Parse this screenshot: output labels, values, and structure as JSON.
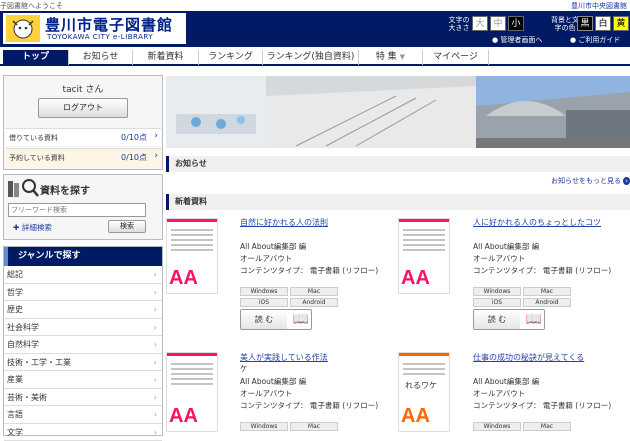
{
  "top": {
    "welcome": "子図書館へようこそ",
    "link": "豊川市中央図書館"
  },
  "header": {
    "logo_title": "豊川市電子図書館",
    "logo_sub": "TOYOKAWA CITY e-LIBRARY",
    "fontsize_label": "文字の大きさ",
    "fontsize_options": [
      "大",
      "中",
      "小"
    ],
    "color_label": "背景と文字の色",
    "color_options": [
      "黒",
      "白",
      "黄"
    ],
    "admin_link": "管理者画面へ",
    "help_link": "ご利用ガイド"
  },
  "nav": [
    "トップ",
    "お知らせ",
    "新着資料",
    "ランキング",
    "ランキング(独自資料)",
    "特 集",
    "マイページ"
  ],
  "user": {
    "name": "tacit さん",
    "logout": "ログアウト",
    "borrowing_label": "借りている資料",
    "borrowing_value": "0/10点",
    "reserved_label": "予約している資料",
    "reserved_value": "0/10点"
  },
  "search": {
    "title": "資料を探す",
    "placeholder": "フリーワード検索",
    "advanced": "詳細検索",
    "button": "検索"
  },
  "genre": {
    "title": "ジャンルで探す",
    "items": [
      "総記",
      "哲学",
      "歴史",
      "社会科学",
      "自然科学",
      "技術・工学・工業",
      "産業",
      "芸術・美術",
      "言語",
      "文学"
    ]
  },
  "sections": {
    "news": "お知らせ",
    "news_more": "お知らせをもっと見る",
    "new": "新着資料"
  },
  "books": [
    {
      "title": "自然に好かれる人の法則",
      "author": "All About編集部 編",
      "publisher": "オールアバウト",
      "type": "コンテンツタイプ： 電子書籍 (リフロー)",
      "tags": [
        "Windows",
        "Mac",
        "iOS",
        "Android"
      ],
      "read": "読 む",
      "cover_color": "#ff1166",
      "cover_text": "AA"
    },
    {
      "title": "人に好かれる人のちょっとしたコツ",
      "author": "All About編集部 編",
      "publisher": "オールアバウト",
      "type": "コンテンツタイプ： 電子書籍 (リフロー)",
      "tags": [
        "Windows",
        "Mac",
        "iOS",
        "Android"
      ],
      "read": "読 む",
      "cover_color": "#ff1166",
      "cover_text": "AA"
    },
    {
      "title": "美人が実践している作法",
      "extra": "ケ",
      "author": "All About編集部 編",
      "publisher": "オールアバウト",
      "type": "コンテンツタイプ： 電子書籍 (リフロー)",
      "tags": [
        "Windows",
        "Mac"
      ],
      "cover_color": "#ff1166",
      "cover_text": "AA"
    },
    {
      "title": "仕事の成功の秘訣が見えてくる",
      "extra": "れるワケ",
      "author": "All About編集部 編",
      "publisher": "オールアバウト",
      "type": "コンテンツタイプ： 電子書籍 (リフロー)",
      "tags": [
        "Windows",
        "Mac"
      ],
      "cover_color": "#ff6600",
      "cover_text": "AA"
    }
  ]
}
